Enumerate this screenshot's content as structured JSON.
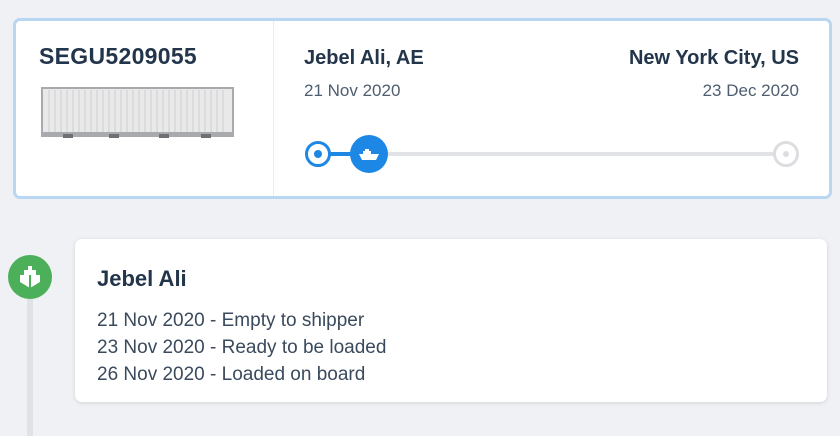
{
  "shipment": {
    "container_id": "SEGU5209055",
    "container_icon": "shipping-container-image",
    "origin": {
      "name": "Jebel Ali, AE",
      "date": "21 Nov 2020"
    },
    "destination": {
      "name": "New York City, US",
      "date": "23 Dec 2020"
    },
    "progress_fraction": 0.11,
    "status_icon": "ship-icon",
    "colors": {
      "accent": "#1c87e5",
      "card_border": "#b9d6f3",
      "track": "#e2e3e6"
    }
  },
  "timeline": {
    "event_icon": "vessel-icon",
    "event_color": "#4cb05a",
    "location": "Jebel Ali",
    "events": [
      "21 Nov 2020 - Empty to shipper",
      "23 Nov 2020 - Ready to be loaded",
      "26 Nov 2020 - Loaded on board"
    ]
  }
}
